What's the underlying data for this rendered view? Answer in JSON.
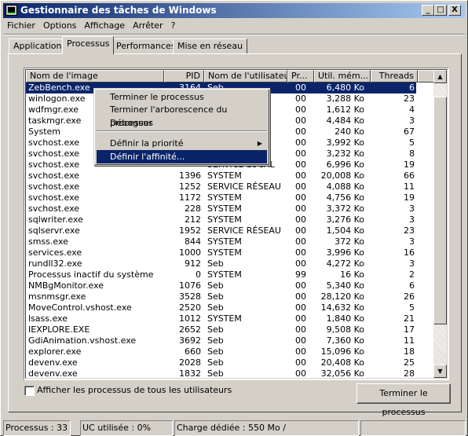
{
  "window": {
    "title": "Gestionnaire des tâches de Windows",
    "controls": [
      "_",
      "□",
      "X"
    ]
  },
  "menu": [
    "Fichier",
    "Options",
    "Affichage",
    "Arrêter",
    "?"
  ],
  "tabs": [
    {
      "label": "Applications",
      "active": false
    },
    {
      "label": "Processus",
      "active": true
    },
    {
      "label": "Performances",
      "active": false
    },
    {
      "label": "Mise en réseau",
      "active": false
    }
  ],
  "columns": [
    "Nom de l'image",
    "PID",
    "Nom de l'utilisateur",
    "Pr...",
    "Util. mém...",
    "Threads"
  ],
  "rows": [
    [
      "ZebBench.exe",
      "3164",
      "Seb",
      "00",
      "6,480 Ko",
      "6"
    ],
    [
      "winlogon.exe",
      "",
      "",
      "00",
      "3,288 Ko",
      "23"
    ],
    [
      "wdfmgr.exe",
      "",
      "",
      "00",
      "1,612 Ko",
      "4"
    ],
    [
      "taskmgr.exe",
      "",
      "",
      "00",
      "4,484 Ko",
      "3"
    ],
    [
      "System",
      "",
      "",
      "00",
      "240 Ko",
      "67"
    ],
    [
      "svchost.exe",
      "",
      "",
      "00",
      "3,992 Ko",
      "5"
    ],
    [
      "svchost.exe",
      "",
      "",
      "00",
      "3,232 Ko",
      "8"
    ],
    [
      "svchost.exe",
      "",
      "SERVICE LOCAL",
      "00",
      "6,996 Ko",
      "19"
    ],
    [
      "svchost.exe",
      "1396",
      "SYSTEM",
      "00",
      "20,008 Ko",
      "66"
    ],
    [
      "svchost.exe",
      "1252",
      "SERVICE RÉSEAU",
      "00",
      "4,088 Ko",
      "11"
    ],
    [
      "svchost.exe",
      "1172",
      "SYSTEM",
      "00",
      "4,756 Ko",
      "19"
    ],
    [
      "svchost.exe",
      "228",
      "SYSTEM",
      "00",
      "3,372 Ko",
      "3"
    ],
    [
      "sqlwriter.exe",
      "212",
      "SYSTEM",
      "00",
      "3,276 Ko",
      "3"
    ],
    [
      "sqlservr.exe",
      "1952",
      "SERVICE RÉSEAU",
      "00",
      "1,504 Ko",
      "23"
    ],
    [
      "smss.exe",
      "844",
      "SYSTEM",
      "00",
      "372 Ko",
      "3"
    ],
    [
      "services.exe",
      "1000",
      "SYSTEM",
      "00",
      "3,996 Ko",
      "16"
    ],
    [
      "rundll32.exe",
      "912",
      "Seb",
      "00",
      "4,272 Ko",
      "3"
    ],
    [
      "Processus inactif du système",
      "0",
      "SYSTEM",
      "99",
      "16 Ko",
      "2"
    ],
    [
      "NMBgMonitor.exe",
      "1076",
      "Seb",
      "00",
      "5,340 Ko",
      "6"
    ],
    [
      "msnmsgr.exe",
      "3528",
      "Seb",
      "00",
      "28,120 Ko",
      "26"
    ],
    [
      "MoveControl.vshost.exe",
      "2520",
      "Seb",
      "00",
      "14,632 Ko",
      "5"
    ],
    [
      "lsass.exe",
      "1012",
      "SYSTEM",
      "00",
      "1,840 Ko",
      "21"
    ],
    [
      "IEXPLORE.EXE",
      "2652",
      "Seb",
      "00",
      "9,508 Ko",
      "17"
    ],
    [
      "GdiAnimation.vshost.exe",
      "3692",
      "Seb",
      "00",
      "7,360 Ko",
      "11"
    ],
    [
      "explorer.exe",
      "660",
      "Seb",
      "00",
      "15,096 Ko",
      "18"
    ],
    [
      "devenv.exe",
      "2028",
      "Seb",
      "00",
      "20,408 Ko",
      "25"
    ],
    [
      "devenv.exe",
      "1832",
      "Seb",
      "00",
      "32,056 Ko",
      "28"
    ]
  ],
  "selected_row": 0,
  "context_menu": {
    "items": [
      "Terminer le processus",
      "Terminer l'arborescence du processus",
      "Déboguer",
      "Définir la priorité",
      "Définir l'affinité..."
    ],
    "highlighted": 4,
    "submenu_arrow": "▶"
  },
  "show_all_users": {
    "label": "Afficher les processus de tous les utilisateurs",
    "checked": false
  },
  "end_process_button": "Terminer le processus",
  "status": [
    "Processus : 33",
    "UC utilisée : 0%",
    "Charge dédiée : 550 Mo /",
    ""
  ],
  "colors": {
    "title_start": "#0a246a",
    "title_end": "#a6caf0",
    "selection": "#0a246a"
  }
}
